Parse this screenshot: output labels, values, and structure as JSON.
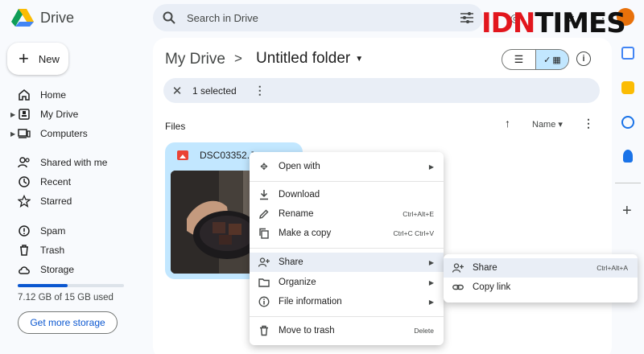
{
  "app": {
    "name": "Drive"
  },
  "search": {
    "placeholder": "Search in Drive"
  },
  "watermark": {
    "part1": "IDN",
    "part2": "TIMES"
  },
  "user": {
    "initial": ""
  },
  "sidebar": {
    "new_label": "New",
    "items": [
      {
        "label": "Home",
        "icon": "home-icon"
      },
      {
        "label": "My Drive",
        "icon": "my-drive-icon"
      },
      {
        "label": "Computers",
        "icon": "computers-icon"
      },
      {
        "label": "Shared with me",
        "icon": "shared-icon"
      },
      {
        "label": "Recent",
        "icon": "clock-icon"
      },
      {
        "label": "Starred",
        "icon": "star-icon"
      },
      {
        "label": "Spam",
        "icon": "spam-icon"
      },
      {
        "label": "Trash",
        "icon": "trash-icon"
      },
      {
        "label": "Storage",
        "icon": "cloud-icon"
      }
    ],
    "storage_used_fraction": 0.47,
    "storage_text": "7.12 GB of 15 GB used",
    "get_storage_label": "Get more storage"
  },
  "breadcrumb": {
    "root": "My Drive",
    "separator": ">",
    "current": "Untitled folder"
  },
  "selection": {
    "count_text": "1 selected"
  },
  "files": {
    "section_label": "Files",
    "sort_label": "Name",
    "items": [
      {
        "name": "DSC03352.J",
        "type": "image"
      }
    ]
  },
  "context_menu": {
    "items": [
      {
        "label": "Open with",
        "icon": "open-with-icon",
        "submenu": true
      },
      {
        "label": "Download",
        "icon": "download-icon"
      },
      {
        "label": "Rename",
        "icon": "rename-icon",
        "shortcut": "Ctrl+Alt+E"
      },
      {
        "label": "Make a copy",
        "icon": "copy-icon",
        "shortcut": "Ctrl+C Ctrl+V"
      },
      {
        "label": "Share",
        "icon": "share-icon",
        "submenu": true
      },
      {
        "label": "Organize",
        "icon": "organize-icon",
        "submenu": true
      },
      {
        "label": "File information",
        "icon": "info-icon",
        "submenu": true
      },
      {
        "label": "Move to trash",
        "icon": "trash-icon",
        "shortcut": "Delete"
      }
    ]
  },
  "share_submenu": {
    "items": [
      {
        "label": "Share",
        "icon": "share-icon",
        "shortcut": "Ctrl+Alt+A"
      },
      {
        "label": "Copy link",
        "icon": "link-icon"
      }
    ]
  },
  "colors": {
    "accent": "#0b57d0",
    "selected": "#c2e7ff",
    "hover": "#e9eef6"
  }
}
